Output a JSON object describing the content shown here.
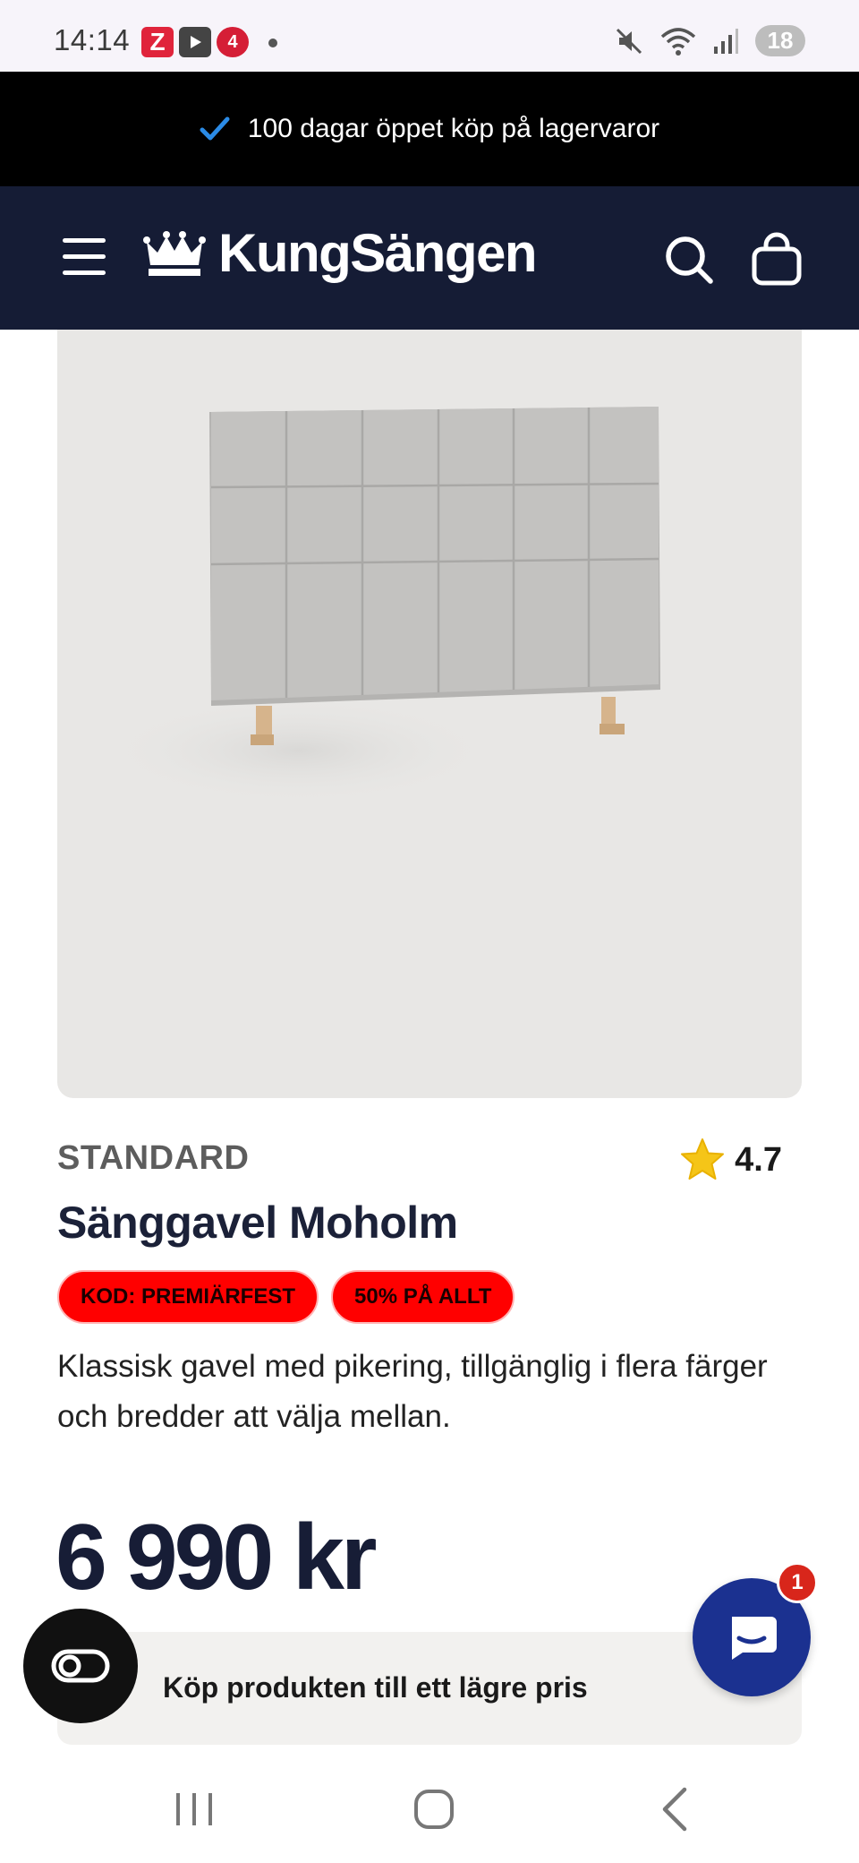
{
  "status_bar": {
    "time": "14:14",
    "notification_icons": [
      "z-app-icon",
      "youtube-icon",
      "channel4-icon"
    ],
    "battery": "18"
  },
  "promo": {
    "text": "100 dagar öppet köp på lagervaror",
    "check_color": "#2b8be6"
  },
  "header": {
    "logo_text": "KungSängen",
    "background": "#151c35"
  },
  "product": {
    "brand": "STANDARD",
    "rating": "4.7",
    "title": "Sänggavel Moholm",
    "badges": [
      "KOD: PREMIÄRFEST",
      "50% PÅ ALLT"
    ],
    "description": "Klassisk gavel med pikering, tillgänglig i flera färger och bredder att välja mellan.",
    "price": "6 990 kr",
    "lower_price_label": "Köp produkten till ett lägre pris"
  },
  "chat": {
    "unread_count": "1"
  },
  "colors": {
    "badge_red": "#ff0000",
    "chat_blue": "#1b3190",
    "star": "#f5c518"
  }
}
